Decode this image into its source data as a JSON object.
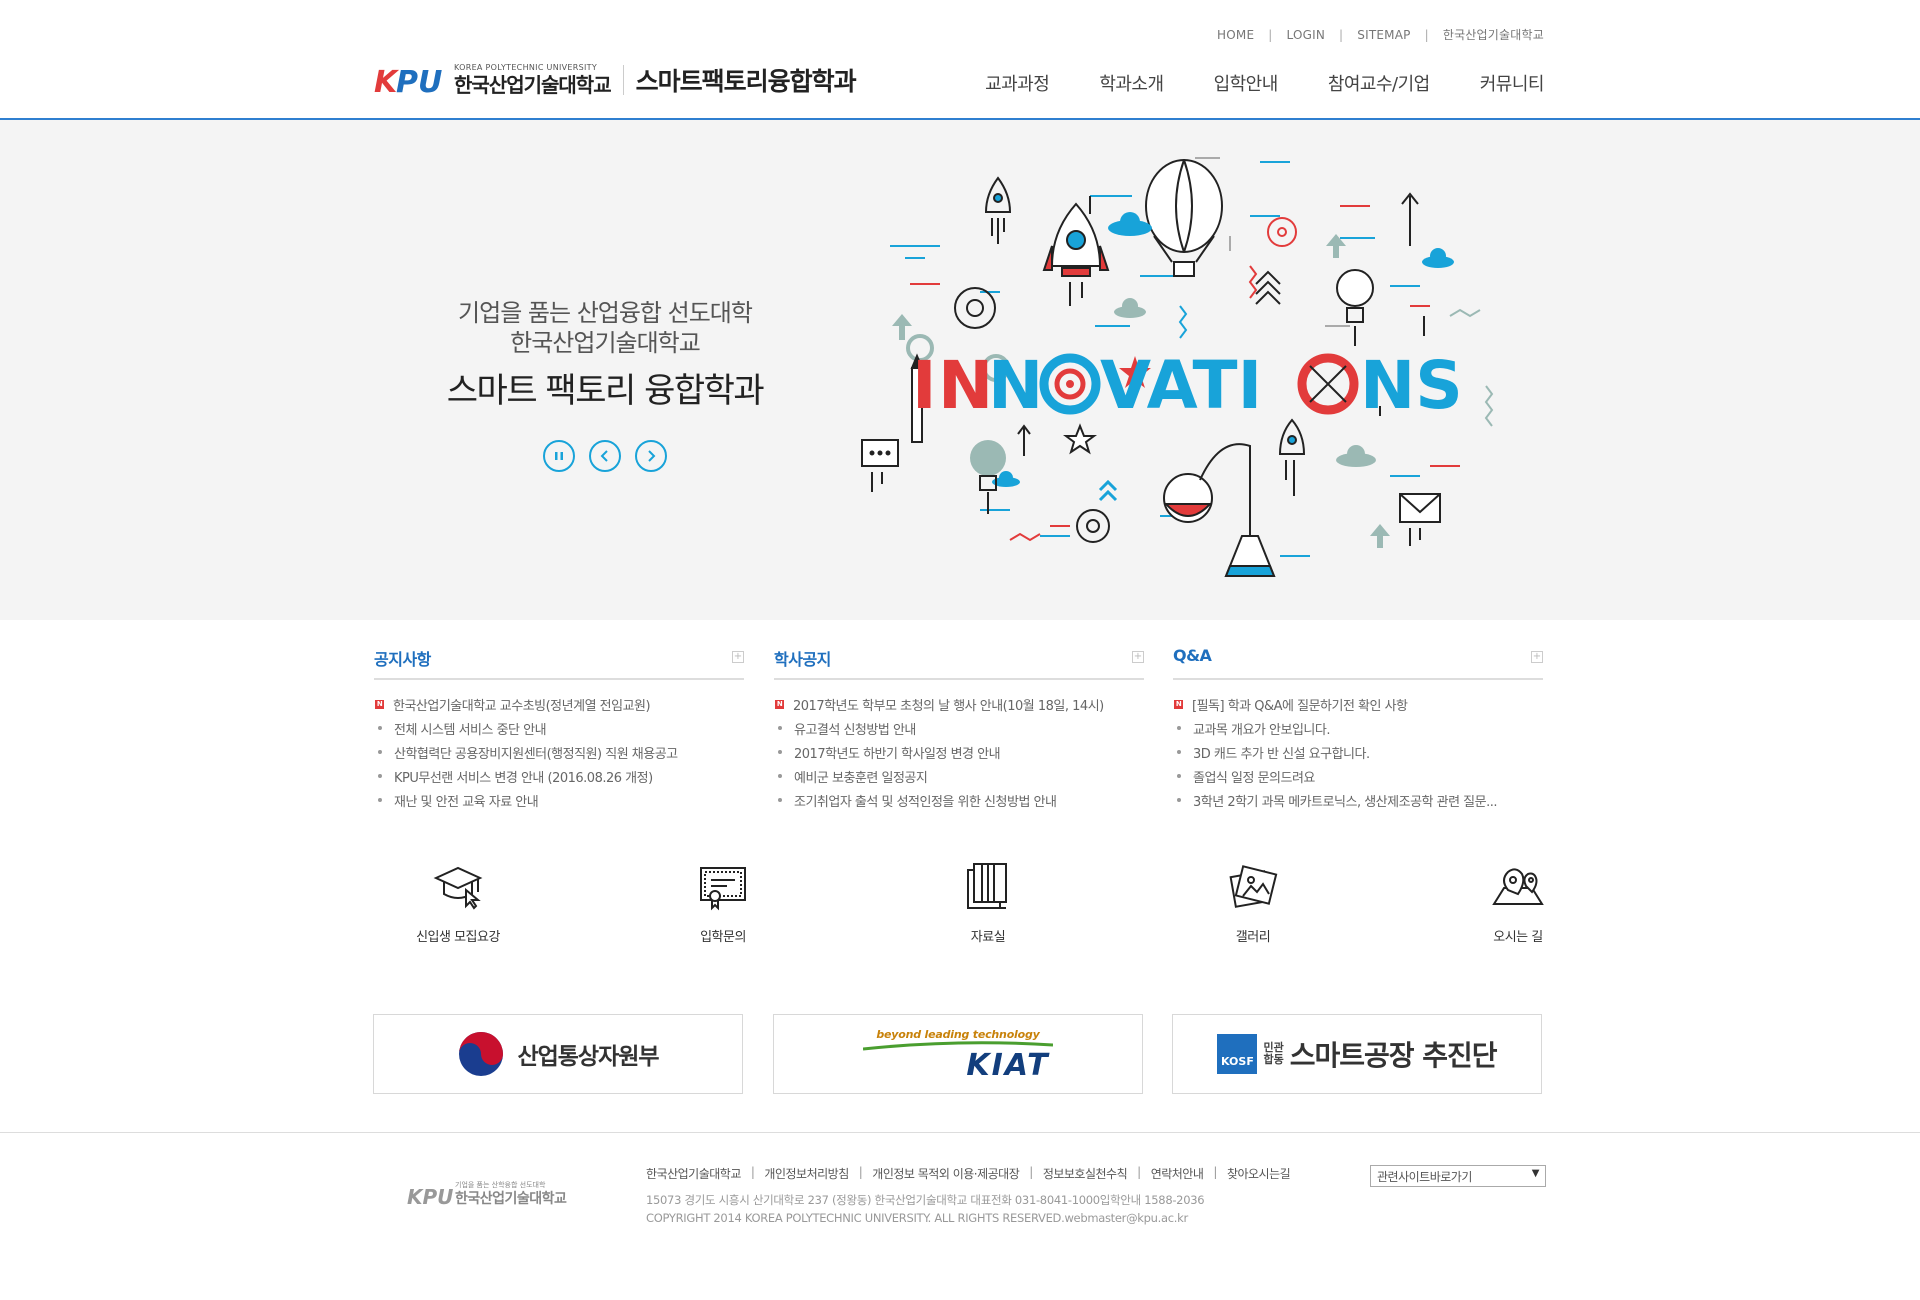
{
  "header": {
    "util_links": [
      "HOME",
      "LOGIN",
      "SITEMAP",
      "한국산업기술대학교"
    ],
    "logo": {
      "mark_text": "KPU",
      "english": "KOREA POLYTECHNIC UNIVERSITY",
      "korean": "한국산업기술대학교"
    },
    "dept_name": "스마트팩토리융합학과",
    "gnb": [
      "교과과정",
      "학과소개",
      "입학안내",
      "참여교수/기업",
      "커뮤니티"
    ]
  },
  "hero": {
    "line1": "기업을 품는 산업융합 선도대학",
    "line2": "한국산업기술대학교",
    "line3": "스마트 팩토리 융합학과",
    "art_word": "INNOVATIONS",
    "controls": {
      "pause": "pause-icon",
      "prev": "chevron-left-icon",
      "next": "chevron-right-icon"
    }
  },
  "boards": [
    {
      "title": "공지사항",
      "more": "+",
      "items": [
        {
          "text": "한국산업기술대학교 교수초빙(정년계열 전임교원)",
          "new": true
        },
        {
          "text": "전체 시스템 서비스 중단 안내",
          "new": false
        },
        {
          "text": "산학협력단 공용장비지원센터(행정직원) 직원 채용공고",
          "new": false
        },
        {
          "text": "KPU무선랜 서비스 변경 안내 (2016.08.26 개정)",
          "new": false
        },
        {
          "text": "재난 및 안전 교육 자료 안내",
          "new": false
        }
      ]
    },
    {
      "title": "학사공지",
      "more": "+",
      "items": [
        {
          "text": "2017학년도 학부모 초청의 날 행사 안내(10월 18일, 14시)",
          "new": true
        },
        {
          "text": "유고결석 신청방법 안내",
          "new": false
        },
        {
          "text": "2017학년도 하반기 학사일정 변경 안내",
          "new": false
        },
        {
          "text": "예비군 보충훈련 일정공지",
          "new": false
        },
        {
          "text": "조기취업자 출석 및 성적인정을 위한 신청방법 안내",
          "new": false
        }
      ]
    },
    {
      "title": "Q&A",
      "more": "+",
      "items": [
        {
          "text": "[필독] 학과 Q&A에 질문하기전 확인 사항",
          "new": true
        },
        {
          "text": "교과목 개요가 안보입니다.",
          "new": false
        },
        {
          "text": "3D 캐드 추가 반 신설 요구합니다.",
          "new": false
        },
        {
          "text": "졸업식 일정 문의드려요",
          "new": false
        },
        {
          "text": "3학년 2학기 과목 메카트로닉스, 생산제조공학 관련 질문...",
          "new": false
        }
      ]
    }
  ],
  "quick_menu": [
    {
      "label": "신입생 모집요강",
      "icon": "graduation-cap-icon"
    },
    {
      "label": "입학문의",
      "icon": "certificate-icon"
    },
    {
      "label": "자료실",
      "icon": "folder-icon"
    },
    {
      "label": "갤러리",
      "icon": "gallery-icon"
    },
    {
      "label": "오시는 길",
      "icon": "map-icon"
    }
  ],
  "banners": {
    "motie": "산업통상자원부",
    "kiat_tagline": "beyond leading technology",
    "kiat_name": "KIAT",
    "kosf_badge": "KOSF",
    "kosf_small_1": "민관",
    "kosf_small_2": "합동",
    "kosf_name": "스마트공장 추진단"
  },
  "footer": {
    "logo_sub": "기업을 품는 산학융합 선도대학",
    "logo_name": "한국산업기술대학교",
    "links": [
      "한국산업기술대학교",
      "개인정보처리방침",
      "개인정보 목적외 이용·제공대장",
      "정보보호실천수칙",
      "연락처안내",
      "찾아오시는길"
    ],
    "address": "15073 경기도 시흥시 산기대학로 237 (정왕동) 한국산업기술대학교 대표전화 031-8041-1000입학안내 1588-2036",
    "copyright": "COPYRIGHT 2014 KOREA POLYTECHNIC UNIVERSITY. ALL RIGHTS RESERVED.webmaster@kpu.ac.kr",
    "family_site": "관련사이트바로가기"
  },
  "colors": {
    "accent_blue": "#1f6fbe",
    "cyan": "#18a3d9",
    "red": "#e23b3b",
    "hero_bg": "#f4f4f4"
  }
}
